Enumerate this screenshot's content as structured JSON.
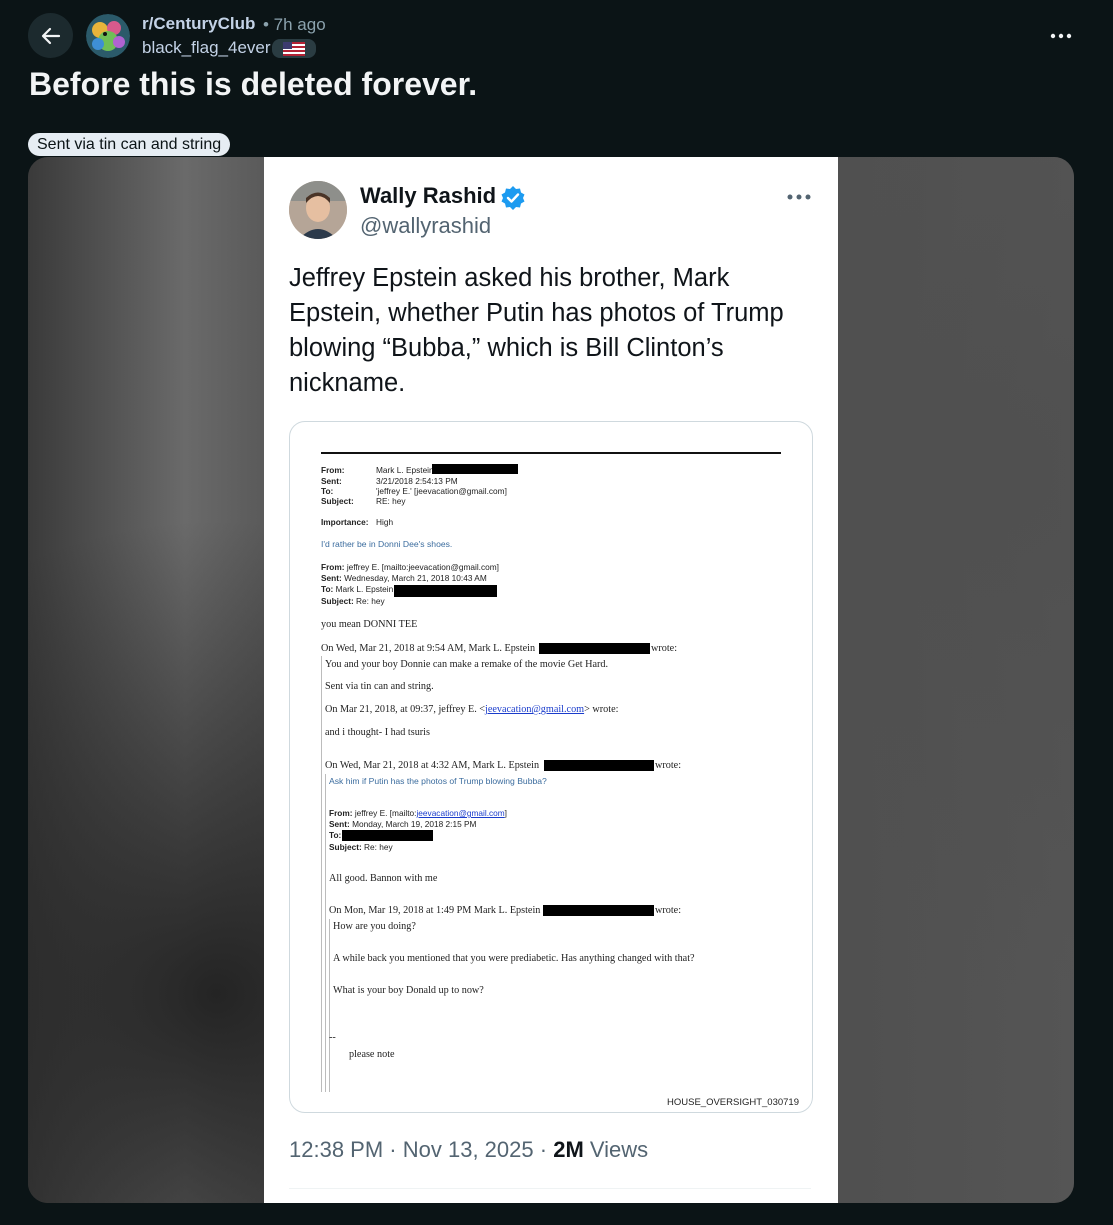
{
  "post": {
    "subreddit": "r/CenturyClub",
    "time_ago": "• 7h ago",
    "author": "black_flag_4ever",
    "title": "Before this is deleted forever.",
    "flair": "Sent via tin can and string"
  },
  "icons": {
    "back": "arrow-left-icon",
    "more": "more-horizontal-icon",
    "flair": "us-flag-icon",
    "verified": "verified-badge-icon"
  },
  "tweet": {
    "name": "Wally Rashid",
    "handle": "@wallyrashid",
    "text": "Jeffrey Epstein asked his brother, Mark Epstein, whether Putin has photos of Trump blowing “Bubba,” which is Bill Clinton’s nickname.",
    "time": "12:38 PM",
    "sep1": "·",
    "date": "Nov 13, 2025",
    "sep2": "·",
    "views_count": "2M",
    "views_label": "Views"
  },
  "document": {
    "h1_from_label": "From:",
    "h1_from": "Mark L. Epstein",
    "h1_sent_label": "Sent:",
    "h1_sent": "3/21/2018 2:54:13 PM",
    "h1_to_label": "To:",
    "h1_to": "'jeffrey E.' [jeevacation@gmail.com]",
    "h1_subject_label": "Subject:",
    "h1_subject": "RE: hey",
    "importance_label": "Importance:",
    "importance": "High",
    "body1": "I'd rather be in Donni Dee's shoes.",
    "h2_from_label": "From:",
    "h2_from": "jeffrey E. [mailto:jeevacation@gmail.com]",
    "h2_sent_label": "Sent:",
    "h2_sent": "Wednesday, March 21, 2018 10:43 AM",
    "h2_to_label": "To:",
    "h2_to": "Mark L. Epstein",
    "h2_subject_label": "Subject:",
    "h2_subject": "Re: hey",
    "body2": "you mean DONNI TEE",
    "on1": "On Wed, Mar 21, 2018 at 9:54 AM, Mark L. Epstein",
    "wrote": "wrote:",
    "body3": "You and your boy Donnie can make a remake of the movie Get Hard.",
    "body4": "Sent via tin can and string.",
    "on2_pre": "On Mar 21, 2018, at 09:37, jeffrey E. <",
    "on2_link": "jeevacation@gmail.com",
    "on2_post": "> wrote:",
    "body5": "and i thought- I had tsuris",
    "on3": "On Wed, Mar 21, 2018 at 4:32 AM, Mark L. Epstein",
    "body6": "Ask him if Putin has the photos of Trump blowing Bubba?",
    "h3_from_label": "From:",
    "h3_from_pre": "jeffrey E. [mailto:",
    "h3_from_link": "jeevacation@gmail.com",
    "h3_from_post": "]",
    "h3_sent_label": "Sent:",
    "h3_sent": "Monday, March 19, 2018 2:15 PM",
    "h3_to_label": "To:",
    "h3_subject_label": "Subject:",
    "h3_subject": "Re: hey",
    "body7": "All good. Bannon with me",
    "on4": "On Mon, Mar 19, 2018 at 1:49 PM Mark L. Epstein",
    "body8": "How are you doing?",
    "body9": "A while back you mentioned that you were prediabetic.  Has anything changed with that?",
    "body10": "What is your boy Donald up to now?",
    "dashes": "--",
    "body11": "please note",
    "footer": "HOUSE_OVERSIGHT_030719"
  }
}
